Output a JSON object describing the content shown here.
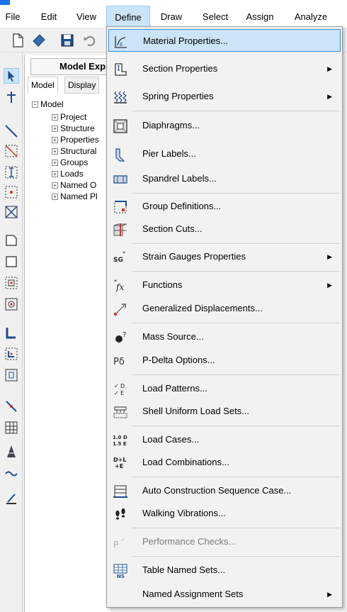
{
  "menubar": {
    "items": [
      "File",
      "Edit",
      "View",
      "Define",
      "Draw",
      "Select",
      "Assign",
      "Analyze"
    ],
    "active": "Define"
  },
  "panel": {
    "title": "Model Exp",
    "tabs": [
      "Model",
      "Display"
    ],
    "tree": {
      "root": "Model",
      "children": [
        "Project",
        "Structure",
        "Properties",
        "Structural",
        "Groups",
        "Loads",
        "Named O",
        "Named Pl"
      ]
    }
  },
  "define_menu": {
    "items": [
      {
        "label": "Material Properties...",
        "icon": "material-properties-icon"
      },
      {
        "label": "Section Properties",
        "icon": "section-properties-icon",
        "submenu": true
      },
      {
        "label": "Spring Properties",
        "icon": "spring-properties-icon",
        "submenu": true
      },
      {
        "label": "Diaphragms...",
        "icon": "diaphragms-icon"
      },
      {
        "label": "Pier Labels...",
        "icon": "pier-labels-icon"
      },
      {
        "label": "Spandrel Labels...",
        "icon": "spandrel-labels-icon"
      },
      {
        "label": "Group Definitions...",
        "icon": "group-definitions-icon"
      },
      {
        "label": "Section Cuts...",
        "icon": "section-cuts-icon"
      },
      {
        "label": "Strain Gauges Properties",
        "icon": "strain-gauges-icon",
        "submenu": true,
        "icon_text": "SG"
      },
      {
        "label": "Functions",
        "icon": "functions-icon",
        "submenu": true,
        "icon_text": "fx"
      },
      {
        "label": "Generalized Displacements...",
        "icon": "generalized-displacements-icon"
      },
      {
        "label": "Mass Source...",
        "icon": "mass-source-icon"
      },
      {
        "label": "P-Delta Options...",
        "icon": "p-delta-icon",
        "icon_text": "Pδ"
      },
      {
        "label": "Load Patterns...",
        "icon": "load-patterns-icon",
        "icon_text": "D\nE"
      },
      {
        "label": "Shell Uniform Load Sets...",
        "icon": "shell-uniform-load-sets-icon"
      },
      {
        "label": "Load Cases...",
        "icon": "load-cases-icon",
        "icon_text": "1.0 D\n1.5 E"
      },
      {
        "label": "Load Combinations...",
        "icon": "load-combinations-icon",
        "icon_text": "D+L\n+E"
      },
      {
        "label": "Auto Construction Sequence Case...",
        "icon": "auto-construction-sequence-icon"
      },
      {
        "label": "Walking Vibrations...",
        "icon": "walking-vibrations-icon"
      },
      {
        "label": "Performance Checks...",
        "icon": "performance-checks-icon",
        "disabled": true
      },
      {
        "label": "Table Named Sets...",
        "icon": "table-named-sets-icon",
        "icon_text": "NS"
      },
      {
        "label": "Named Assignment Sets",
        "icon": "named-assignment-sets-icon",
        "submenu": true
      }
    ],
    "highlighted": "Material Properties..."
  },
  "colors": {
    "menu_hover": "#cce4f7",
    "menu_hover_border": "#3d8ee0",
    "disabled_text": "#7a7a7a",
    "accent_blue": "#1a73e8",
    "icon_red": "#c0392b"
  }
}
